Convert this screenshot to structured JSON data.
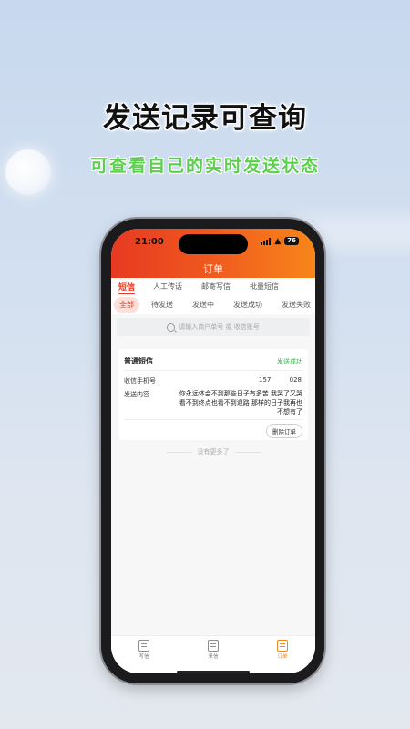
{
  "promo": {
    "title": "发送记录可查询",
    "subtitle": "可查看自己的实时发送状态"
  },
  "status_bar": {
    "time": "21:00",
    "battery": "76"
  },
  "header": {
    "title": "订单"
  },
  "top_tabs": [
    "短信",
    "人工传话",
    "邮寄写信",
    "批量短信"
  ],
  "sub_tabs": [
    "全部",
    "待发送",
    "发送中",
    "发送成功",
    "发送失败"
  ],
  "search": {
    "placeholder": "请输入商户单号 或 收信账号"
  },
  "card": {
    "title": "普通短信",
    "status": "发送成功",
    "phone_label": "收信手机号",
    "phone_prefix": "157",
    "phone_suffix": "028",
    "content_label": "发送内容",
    "content": "你永远体会不到那些日子有多苦 我哭了又哭 看不到终点也看不到退路 那样的日子我再也不想有了",
    "delete_button": "删除订单"
  },
  "list_end": "没有更多了",
  "tab_bar": [
    {
      "label": "写信",
      "icon": "pen-icon"
    },
    {
      "label": "来信",
      "icon": "inbox-icon"
    },
    {
      "label": "订单",
      "icon": "order-icon"
    }
  ],
  "colors": {
    "accent": "#e53a24",
    "success": "#34b34a",
    "promo_green": "#5dcf4f",
    "tab_active": "#f08a1e"
  }
}
